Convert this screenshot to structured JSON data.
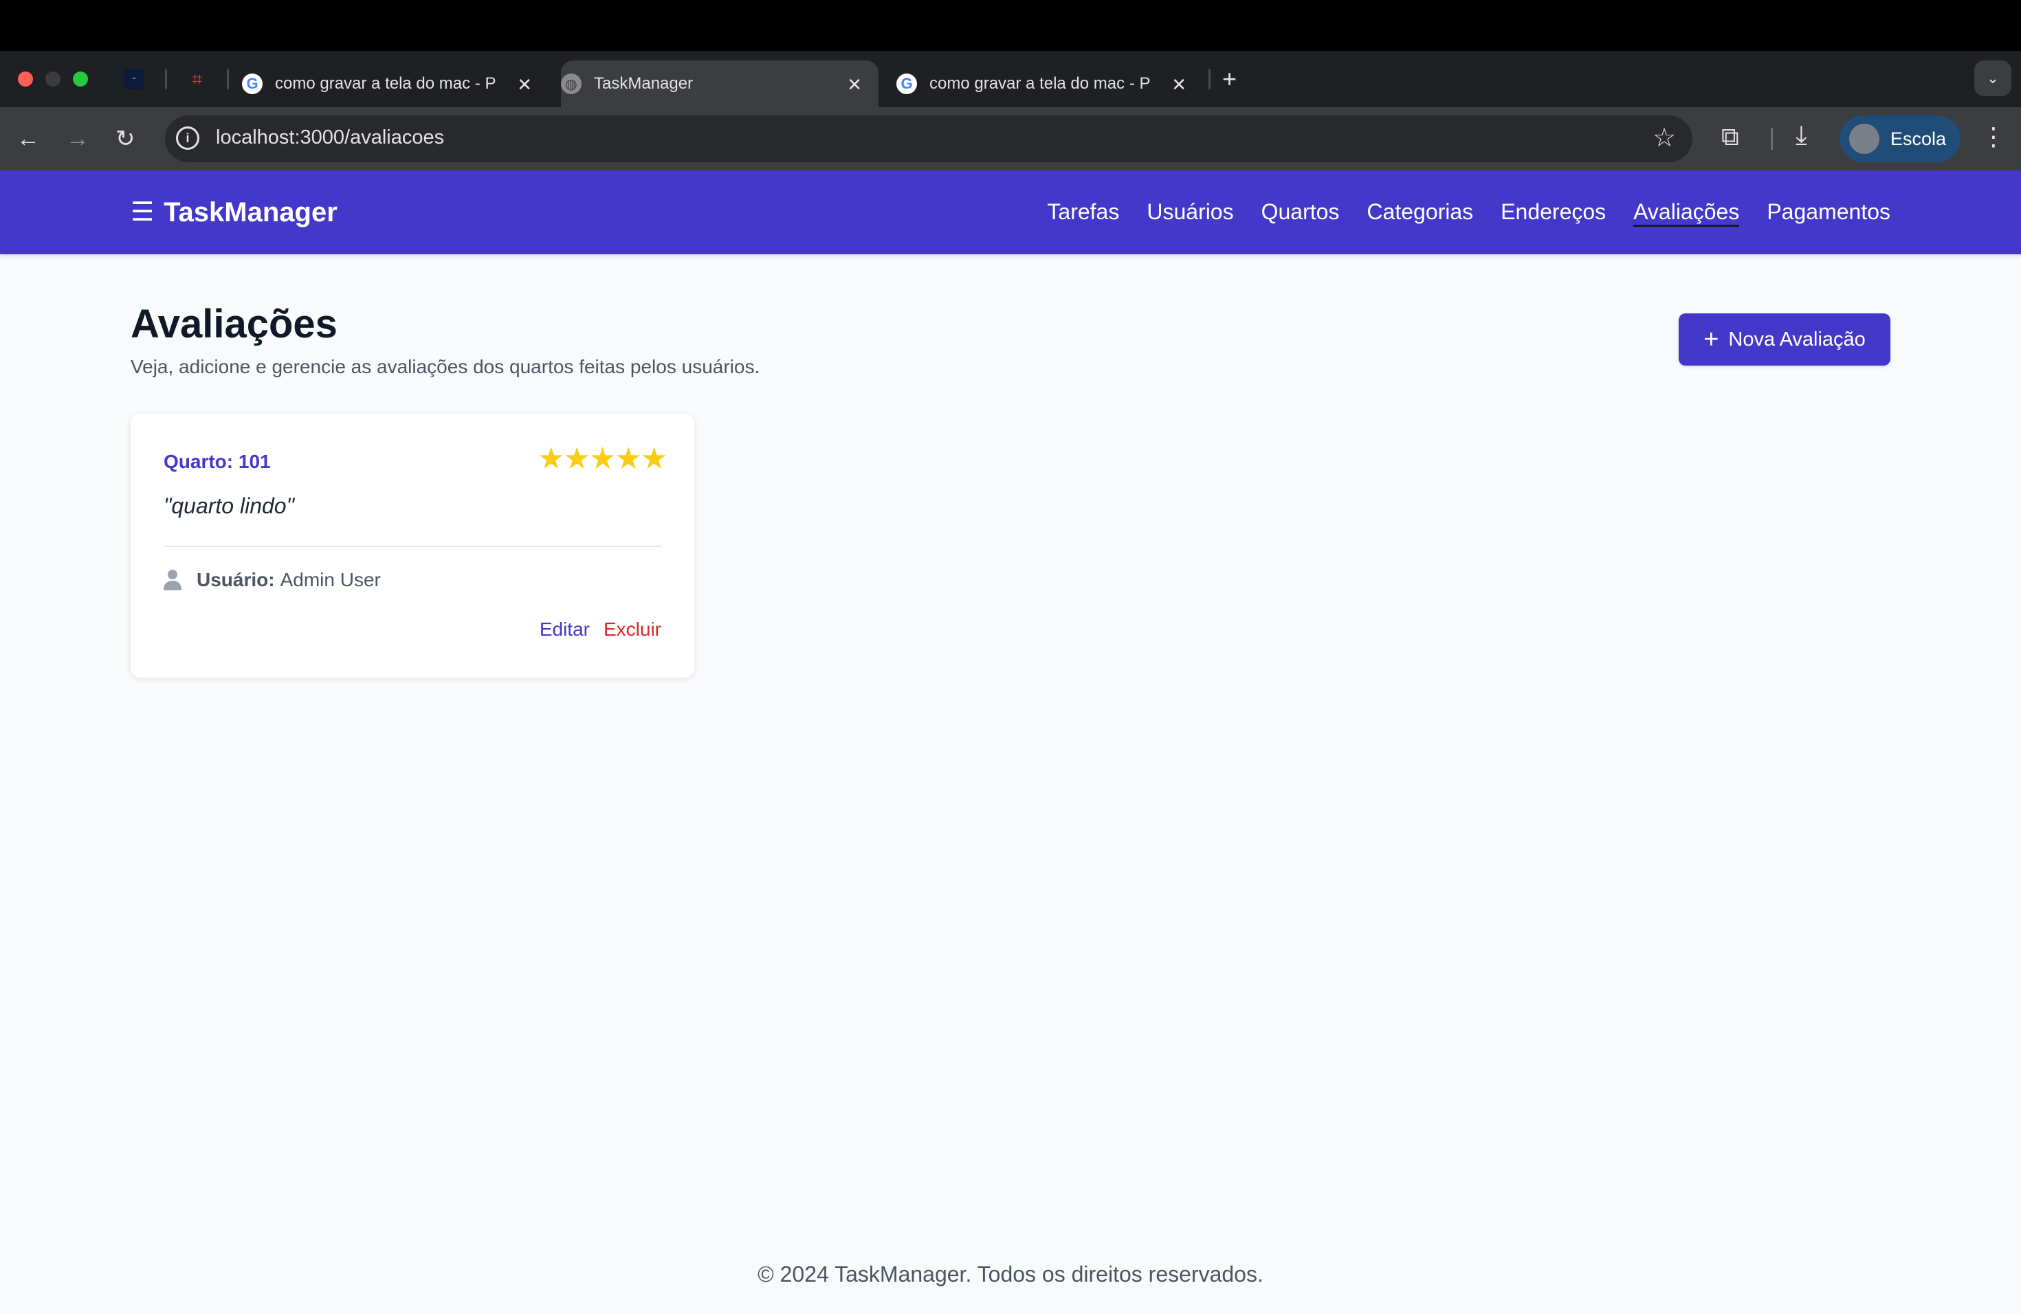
{
  "browser": {
    "tabs": [
      {
        "title": "como gravar a tela do mac - P",
        "favicon": "google-icon"
      },
      {
        "title": "TaskManager",
        "favicon": "globe-icon"
      },
      {
        "title": "como gravar a tela do mac - P",
        "favicon": "google-icon"
      }
    ],
    "url": "localhost:3000/avaliacoes",
    "profile_name": "Escola"
  },
  "app": {
    "brand": "TaskManager",
    "nav": [
      "Tarefas",
      "Usuários",
      "Quartos",
      "Categorias",
      "Endereços",
      "Avaliações",
      "Pagamentos"
    ],
    "active_nav": "Avaliações",
    "accent_color": "#4338ca"
  },
  "page": {
    "title": "Avaliações",
    "subtitle": "Veja, adicione e gerencie as avaliações dos quartos feitas pelos usuários.",
    "new_button": "Nova Avaliação"
  },
  "reviews": [
    {
      "room_label": "Quarto:",
      "room_number": "101",
      "rating": 5,
      "comment": "\"quarto lindo\"",
      "user_label": "Usuário:",
      "user_name": "Admin User",
      "edit_label": "Editar",
      "delete_label": "Excluir"
    }
  ],
  "footer": "© 2024 TaskManager. Todos os direitos reservados."
}
